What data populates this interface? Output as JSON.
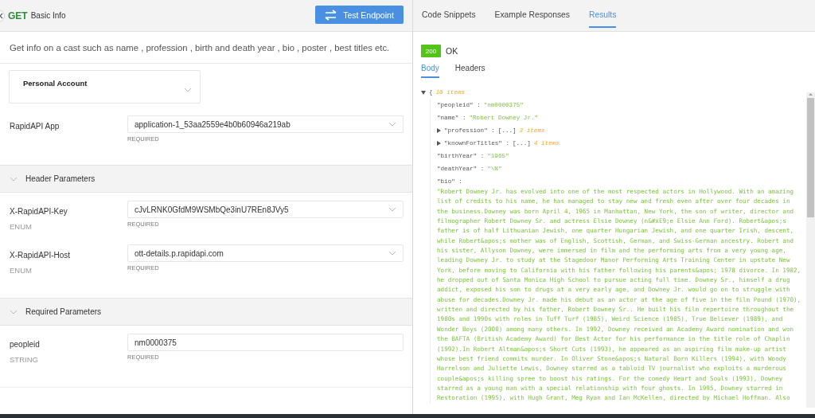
{
  "endpoint": {
    "method": "GET",
    "name": "Basic Info",
    "button": "Test Endpoint",
    "description": "Get info on a cast such as name , profession , birth and death year , bio , poster , best titles etc."
  },
  "account": {
    "label": "Personal Account"
  },
  "app": {
    "label": "RapidAPI App",
    "value": "application-1_53aa2559e4b0b60946a219ab",
    "note": "REQUIRED"
  },
  "sections": [
    {
      "title": "Header Parameters",
      "expanded": true,
      "params": [
        {
          "name": "X-RapidAPI-Key",
          "type": "ENUM",
          "kind": "select",
          "value": "cJvLRNK0GfdM9WSMbQe3inU7REn8JVy5",
          "note": "REQUIRED"
        },
        {
          "name": "X-RapidAPI-Host",
          "type": "ENUM",
          "kind": "select",
          "value": "ott-details.p.rapidapi.com",
          "note": "REQUIRED"
        }
      ]
    },
    {
      "title": "Required Parameters",
      "expanded": true,
      "params": [
        {
          "name": "peopleid",
          "type": "STRING",
          "kind": "text",
          "value": "nm0000375",
          "note": "REQUIRED"
        }
      ]
    }
  ],
  "result_tabs": [
    {
      "label": "Code Snippets",
      "selected": false
    },
    {
      "label": "Example Responses",
      "selected": false
    },
    {
      "label": "Results",
      "selected": true
    }
  ],
  "status": {
    "code": "200",
    "text": "OK"
  },
  "body_tabs": [
    {
      "label": "Body",
      "selected": true
    },
    {
      "label": "Headers",
      "selected": false
    }
  ],
  "response": {
    "open": "{",
    "summary": "10 items",
    "expanded": true,
    "entries": [
      {
        "kind": "value",
        "key": "\"peopleid\" :",
        "value": "\"nm0000375\""
      },
      {
        "kind": "value",
        "key": "\"name\" :",
        "value": "\"Robert Downey Jr.\""
      },
      {
        "kind": "array",
        "key": "\"profession\" :",
        "preview": "[...]",
        "count": "3 items",
        "expanded": false
      },
      {
        "kind": "array",
        "key": "\"knownForTitles\" :",
        "preview": "[...]",
        "count": "4 items",
        "expanded": false
      },
      {
        "kind": "value",
        "key": "\"birthYear\" :",
        "value": "\"1965\""
      },
      {
        "kind": "value",
        "key": "\"deathYear\" :",
        "value": "\"\\N\""
      },
      {
        "kind": "text",
        "key": "\"bio\" :",
        "lines": [
          "\"Robert Downey Jr. has evolved into one of the most respected actors in Hollywood. With an amazing",
          "list of credits to his name, he has managed to stay new and fresh even after over four decades in",
          "the business.Downey was born April 4, 1965 in Manhattan, New York, the son of writer, director and",
          "filmographer Robert Downey Sr. and actress Elsie Downey (n&#xE9;e Elsie Ann Ford). Robert&apos;s",
          "father is of half Lithuanian Jewish, one quarter Hungarian Jewish, and one quarter Irish, descent,",
          "while Robert&apos;s mother was of English, Scottish, German, and Swiss-German ancestry. Robert and",
          "his sister, Allyson Downey, were immersed in film and the performing arts from a very young age,",
          "leading Downey Jr. to study at the Stagedoor Manor Performing Arts Training Center in upstate New",
          "York, before moving to California with his father following his parents&apos; 1978 divorce. In 1982,",
          "he dropped out of Santa Monica High School to pursue acting full time. Downey Sr., himself a drug",
          "addict, exposed his son to drugs at a very early age, and Downey Jr. would go on to struggle with",
          "abuse for decades.Downey Jr. made his debut as an actor at the age of five in the film Pound (1970),",
          "written and directed by his father, Robert Downey Sr.. He built his film repertoire throughout the",
          "1980s and 1990s with roles in Tuff Turf (1985), Weird Science (1985), True Believer (1989), and",
          "Wonder Boys (2000) among many others. In 1992, Downey received an Academy Award nomination and won",
          "the BAFTA (British Academy Award) for Best Actor for his performance in the title role of Chaplin",
          "(1992).In Robert Altman&apos;s Short Cuts (1993), he appeared as an aspiring film make-up artist",
          "whose best friend commits murder. In Oliver Stone&apos;s Natural Born Killers (1994), with Woody",
          "Harrelson and Juliette Lewis, Downey starred as a tabloid TV journalist who exploits a murderous",
          "couple&apos;s killing spree to boost his ratings. For the comedy Heart and Souls (1993), Downey",
          "starred as a young man with a special relationship with four ghosts. In 1995, Downey starred in",
          "Restoration (1995), with Hugh Grant, Meg Ryan and Ian McKellen, directed by Michael Hoffman. Also"
        ]
      }
    ]
  }
}
